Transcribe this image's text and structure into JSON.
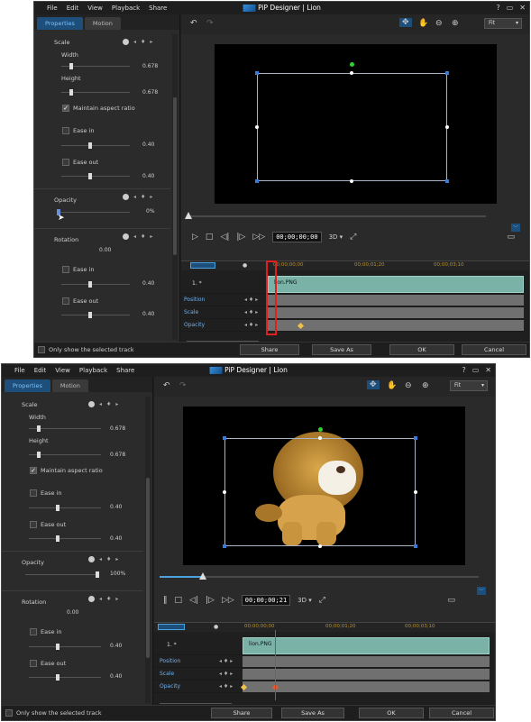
{
  "menu": [
    "File",
    "Edit",
    "View",
    "Playback",
    "Share"
  ],
  "title": "PiP Designer | Lion",
  "winbtns": [
    "?",
    "▭",
    "✕"
  ],
  "tabs": {
    "properties": "Properties",
    "motion": "Motion"
  },
  "scale": {
    "label": "Scale",
    "width_label": "Width",
    "width_value": "0.678",
    "height_label": "Height",
    "height_value": "0.678",
    "maintain": "Maintain aspect ratio",
    "ease_in": "Ease in",
    "ease_in_value": "0.40",
    "ease_out": "Ease out",
    "ease_out_value": "0.40"
  },
  "opacity": {
    "label": "Opacity",
    "value_top": "0%",
    "value_bottom": "100%"
  },
  "rotation": {
    "label": "Rotation",
    "value": "0.00",
    "ease_in": "Ease in",
    "ease_in_value": "0.40",
    "ease_out": "Ease out",
    "ease_out_value": "0.40"
  },
  "toolbar": {
    "fit": "Fit"
  },
  "playback": {
    "timecode_top": "00;00;00;00",
    "timecode_bottom": "00;00;00;21",
    "mode": "3D"
  },
  "timeline": {
    "ruler_labels": [
      "00;00;00;00",
      "00;00;01;20",
      "00;00;03;10"
    ],
    "track_name": "1. *",
    "clip_name": "lion.PNG",
    "rows": [
      "Position",
      "Scale",
      "Opacity"
    ]
  },
  "footer": {
    "only_selected": "Only show the selected track",
    "share": "Share",
    "save_as": "Save As",
    "ok": "OK",
    "cancel": "Cancel"
  },
  "playhead_position_fraction": {
    "top": 0.0,
    "bottom": 0.18
  }
}
